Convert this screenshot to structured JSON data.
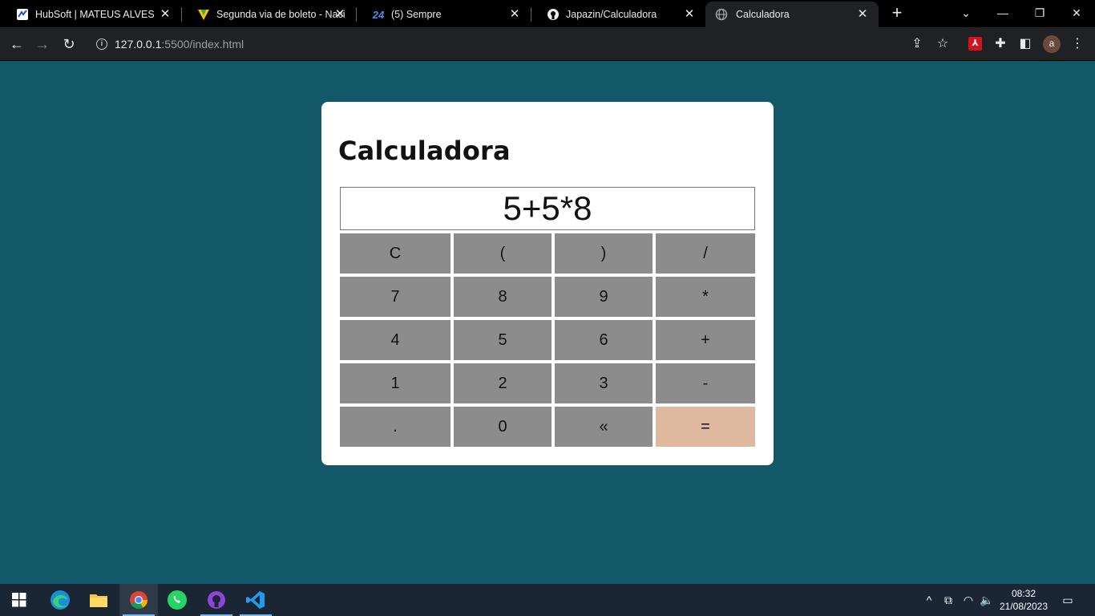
{
  "browser": {
    "tabs": [
      {
        "title": "HubSoft | MATEUS ALVES",
        "icon": "hubsoft-icon"
      },
      {
        "title": "Segunda via de boleto - Naci",
        "icon": "vivo-icon"
      },
      {
        "title": "(5) Sempre",
        "icon": "24-icon"
      },
      {
        "title": "Japazin/Calculadora",
        "icon": "github-icon"
      },
      {
        "title": "Calculadora",
        "icon": "globe-icon"
      }
    ],
    "new_tab": "+",
    "url_host": "127.0.0.1",
    "url_rest": ":5500/index.html",
    "profile_initial": "a"
  },
  "page": {
    "title": "Calculadora",
    "display_value": "5+5*8",
    "keys": [
      "C",
      "(",
      ")",
      "/",
      "7",
      "8",
      "9",
      "*",
      "4",
      "5",
      "6",
      "+",
      "1",
      "2",
      "3",
      "-",
      ".",
      "0",
      "«",
      "="
    ]
  },
  "taskbar": {
    "apps": [
      "edge-icon",
      "file-explorer-icon",
      "chrome-icon",
      "whatsapp-icon",
      "github-desktop-icon",
      "vscode-icon"
    ],
    "time": "08:32",
    "date": "21/08/2023"
  },
  "colors": {
    "page_bg": "#125868",
    "key_bg": "#8c8c8c",
    "equals_bg": "#deb9a0"
  }
}
